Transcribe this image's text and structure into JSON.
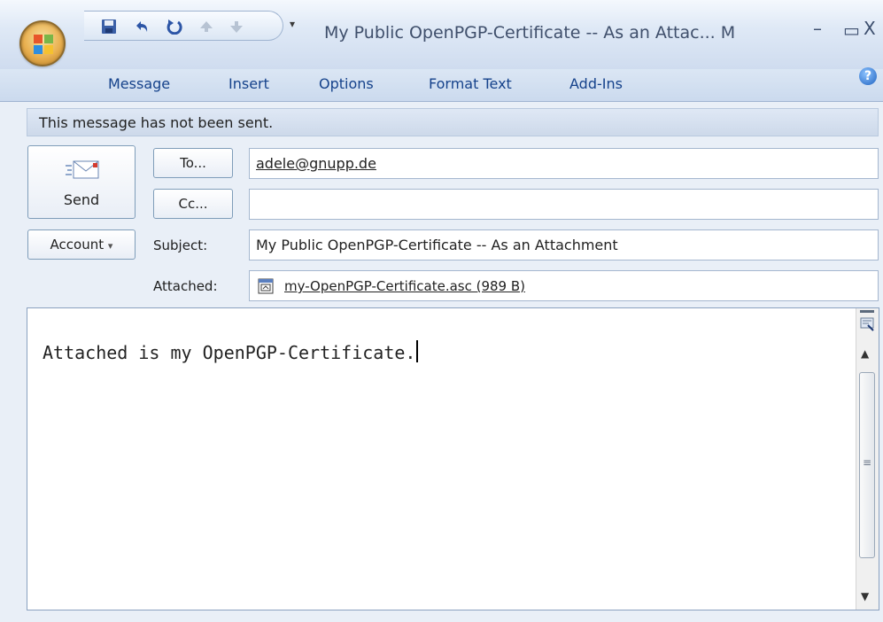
{
  "window": {
    "title": "My Public OpenPGP-Certificate -- As an Attac... M",
    "minimize_glyph": "–",
    "maximize_glyph": "▭",
    "close_glyph": "X",
    "qat_dropdown_glyph": "▾"
  },
  "ribbon": {
    "tabs": [
      "Message",
      "Insert",
      "Options",
      "Format Text",
      "Add-Ins"
    ],
    "help_glyph": "?"
  },
  "infobar": {
    "text": "This message has not been sent."
  },
  "compose": {
    "send_label": "Send",
    "to_button": "To...",
    "cc_button": "Cc...",
    "account_button": "Account",
    "account_arrow": "▾",
    "to_value": "adele@gnupp.de",
    "cc_value": "",
    "subject_label": "Subject:",
    "subject_value": "My Public OpenPGP-Certificate -- As an Attachment",
    "attached_label": "Attached:",
    "attachment_name": "my-OpenPGP-Certificate.asc (989 B)"
  },
  "body": {
    "text": "Attached is my OpenPGP-Certificate."
  },
  "scrollbar": {
    "up_glyph": "▲",
    "down_glyph": "▼",
    "grip_glyph": "≡"
  }
}
